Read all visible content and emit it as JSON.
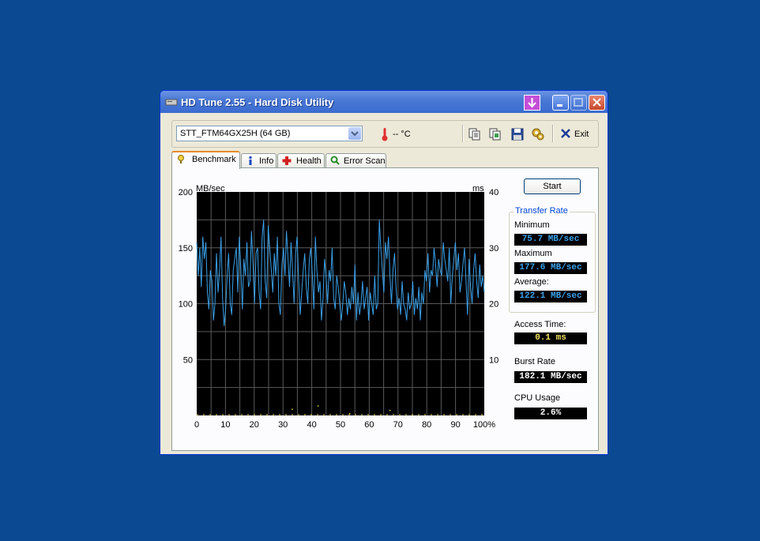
{
  "window": {
    "title": "HD Tune 2.55 - Hard Disk Utility"
  },
  "toolbar": {
    "drive": "STT_FTM64GX25H (64 GB)",
    "temperature": "-- °C",
    "exit_label": "Exit",
    "icons": [
      "copy-text-icon",
      "copy-screenshot-icon",
      "save-icon",
      "options-icon"
    ]
  },
  "tabs": [
    {
      "label": "Benchmark",
      "icon": "benchmark-icon",
      "active": true
    },
    {
      "label": "Info",
      "icon": "info-icon",
      "active": false
    },
    {
      "label": "Health",
      "icon": "health-icon",
      "active": false
    },
    {
      "label": "Error Scan",
      "icon": "error-scan-icon",
      "active": false
    }
  ],
  "benchmark": {
    "start_label": "Start",
    "transfer_rate_title": "Transfer Rate",
    "minimum_label": "Minimum",
    "minimum_value": "75.7 MB/sec",
    "maximum_label": "Maximum",
    "maximum_value": "177.6 MB/sec",
    "average_label": "Average:",
    "average_value": "122.1 MB/sec",
    "access_time_label": "Access Time:",
    "access_time_value": "0.1 ms",
    "burst_rate_label": "Burst Rate",
    "burst_rate_value": "182.1 MB/sec",
    "cpu_usage_label": "CPU Usage",
    "cpu_usage_value": "2.6%"
  },
  "colors": {
    "desktop": "#0b4a92",
    "chart_bg": "#000000",
    "grid": "#5a5a5a",
    "transfer_line": "#3aa0e8",
    "access_points": "#e8d64a",
    "stat_blue": "#3aa0e8",
    "stat_yellow": "#f0e060",
    "stat_white": "#ffffff"
  },
  "chart_data": {
    "type": "line",
    "ylabel": "MB/sec",
    "y2label": "ms",
    "ylim": [
      0,
      200
    ],
    "y2lim": [
      0,
      40
    ],
    "yticks": [
      "200",
      "150",
      "100",
      "50"
    ],
    "y2ticks": [
      "40",
      "30",
      "20",
      "10"
    ],
    "xticks": [
      "0",
      "10",
      "20",
      "30",
      "40",
      "50",
      "60",
      "70",
      "80",
      "90",
      "100%"
    ],
    "xlim": [
      0,
      100
    ],
    "grid": true,
    "series": [
      {
        "values": [
          155,
          125,
          150,
          115,
          160,
          140,
          155,
          110,
          95,
          130,
          120,
          85,
          100,
          145,
          110,
          130,
          160,
          105,
          80,
          95,
          125,
          145,
          100,
          90,
          130,
          140,
          150,
          110,
          160,
          130,
          95,
          140,
          125,
          155,
          115,
          120,
          165,
          135,
          100,
          145,
          150,
          110,
          95,
          160,
          175,
          120,
          105,
          170,
          150,
          130,
          110,
          145,
          125,
          160,
          100,
          90,
          135,
          150,
          125,
          165,
          140,
          115,
          155,
          130,
          100,
          145,
          160,
          120,
          90,
          110,
          130,
          145,
          115,
          100,
          140,
          150,
          125,
          95,
          160,
          130,
          110,
          120,
          85,
          105,
          140,
          125,
          100,
          130,
          120,
          150,
          105,
          95,
          125,
          115,
          100,
          85,
          100,
          120,
          110,
          90,
          105,
          95,
          115,
          100,
          135,
          85,
          110,
          90,
          100,
          120,
          95,
          105,
          115,
          85,
          110,
          100,
          90,
          125,
          95,
          100,
          175,
          150,
          130,
          110,
          155,
          140,
          160,
          125,
          100,
          130,
          145,
          115,
          95,
          105,
          90,
          120,
          100,
          95,
          85,
          110,
          95,
          100,
          120,
          90,
          105,
          95,
          115,
          85,
          110,
          100,
          130,
          120,
          145,
          110,
          130,
          125,
          150,
          135,
          115,
          140,
          130,
          125,
          155,
          140,
          130,
          120,
          150,
          100,
          125,
          140,
          155,
          130,
          145,
          110,
          120,
          135,
          150,
          120,
          90,
          140,
          115,
          100,
          130,
          145,
          120,
          105,
          135,
          115,
          125,
          110
        ]
      },
      {
        "name": "access time",
        "axis": "y2",
        "points": [
          [
            33,
            6
          ],
          [
            42,
            9
          ],
          [
            53,
            2
          ],
          [
            67,
            5
          ]
        ]
      }
    ]
  }
}
